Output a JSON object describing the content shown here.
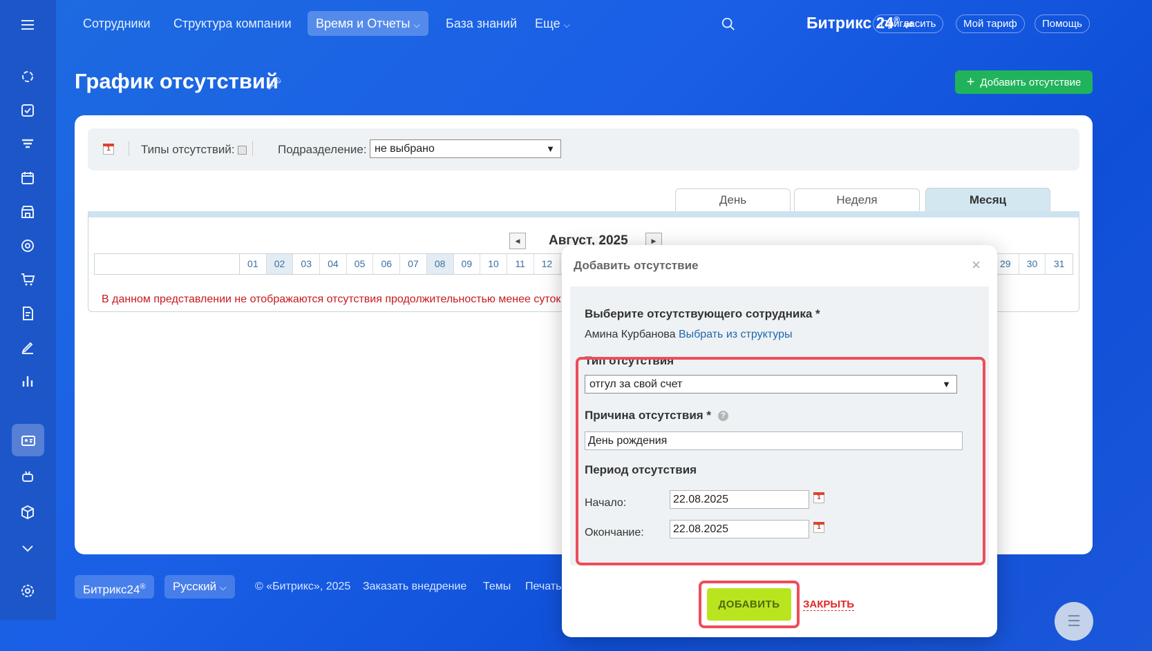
{
  "nav": {
    "items": [
      "Сотрудники",
      "Структура компании",
      "Время и Отчеты",
      "База знаний",
      "Еще"
    ],
    "brand": "Битрикс 24",
    "invite": "Пригласить",
    "tariff": "Мой тариф",
    "help": "Помощь"
  },
  "page": {
    "title": "График отсутствий",
    "add_button": "Добавить отсутствие"
  },
  "filters": {
    "types_label": "Типы отсутствий:",
    "department_label": "Подразделение:",
    "department_value": "не выбрано"
  },
  "tabs": [
    "День",
    "Неделя",
    "Месяц"
  ],
  "calendar": {
    "month": "Август, 2025",
    "days_left": [
      "01",
      "02",
      "03",
      "04",
      "05",
      "06",
      "07",
      "08",
      "09",
      "10",
      "11",
      "12"
    ],
    "days_right": [
      "29",
      "30",
      "31"
    ],
    "warning": "В данном представлении не отображаются отсутствия продолжительностью менее суток"
  },
  "footer": {
    "brand": "Битрикс24",
    "language": "Русский",
    "copyright": "© «Битрикс», 2025",
    "order": "Заказать внедрение",
    "themes": "Темы",
    "print": "Печать"
  },
  "dialog": {
    "title": "Добавить отсутствие",
    "employee_label": "Выберите отсутствующего сотрудника *",
    "employee_name": "Амина Курбанова",
    "employee_link": "Выбрать из структуры",
    "type_label": "Тип отсутствия",
    "type_value": "отгул за свой счет",
    "reason_label": "Причина отсутствия *",
    "reason_value": "День рождения",
    "period_label": "Период отсутствия",
    "start_label": "Начало:",
    "start_value": "22.08.2025",
    "end_label": "Окончание:",
    "end_value": "22.08.2025",
    "submit": "ДОБАВИТЬ",
    "close": "ЗАКРЫТЬ"
  },
  "colors": {
    "accent_green": "#21b35b",
    "submit_lime": "#b9e51f",
    "highlight_red": "#ef4c58"
  }
}
